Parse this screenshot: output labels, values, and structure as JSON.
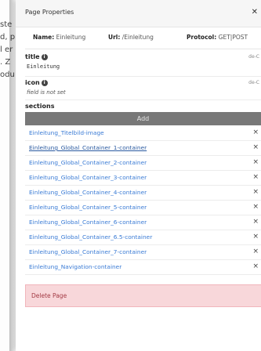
{
  "background": {
    "fragments": [
      "ste",
      "d, p",
      "l er",
      ". Z",
      "odu"
    ]
  },
  "modal": {
    "title": "Page Properties",
    "close_icon": "close-icon",
    "meta": {
      "name_label": "Name:",
      "name_value": "Einleitung",
      "url_label": "Url:",
      "url_value": "/Einleitung",
      "protocol_label": "Protocol:",
      "protocol_value": "GET|POST"
    },
    "fields": {
      "title_label": "title",
      "title_lang": "de-C",
      "title_value": "Einleitung",
      "icon_label": "icon",
      "icon_lang": "de-C",
      "icon_value": "field is not set"
    },
    "sections": {
      "label": "sections",
      "add_label": "Add",
      "items": [
        "Einleitung_Titelbild-image",
        "Einleitung_Global_Container_1-container",
        "Einleitung_Global_Container_2-container",
        "Einleitung_Global_Container_3-container",
        "Einleitung_Global_Container_4-container",
        "Einleitung_Global_Container_5-container",
        "Einleitung_Global_Container_6-container",
        "Einleitung_Global_Container_6.5-container",
        "Einleitung_Global_Container_7-container",
        "Einleitung_Navigation-container"
      ],
      "remove_symbol": "×"
    },
    "delete_label": "Delete Page"
  },
  "colors": {
    "link": "#3a7bd5",
    "add_button": "#787878",
    "delete_bg": "#f8d7da",
    "delete_text": "#a33a44"
  }
}
